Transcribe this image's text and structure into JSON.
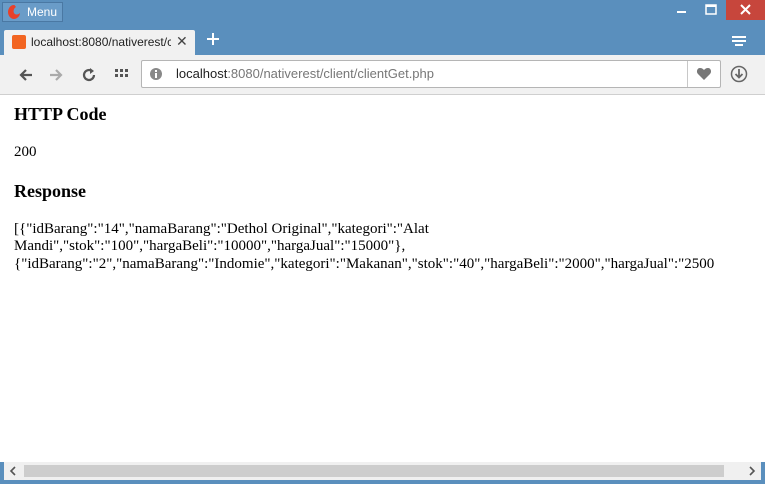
{
  "window": {
    "menu_label": "Menu",
    "accent": "#5a8fbd",
    "close_color": "#c7463c"
  },
  "tab": {
    "title": "localhost:8080/nativerest/c",
    "favicon": "xampp-icon"
  },
  "urlbar": {
    "host": "localhost",
    "path": ":8080/nativerest/client/clientGet.php"
  },
  "page": {
    "http_code_heading": "HTTP Code",
    "http_code_value": "200",
    "response_heading": "Response",
    "response_line1": "[{\"idBarang\":\"14\",\"namaBarang\":\"Dethol Original\",\"kategori\":\"Alat",
    "response_line2": "Mandi\",\"stok\":\"100\",\"hargaBeli\":\"10000\",\"hargaJual\":\"15000\"},",
    "response_line3": "{\"idBarang\":\"2\",\"namaBarang\":\"Indomie\",\"kategori\":\"Makanan\",\"stok\":\"40\",\"hargaBeli\":\"2000\",\"hargaJual\":\"2500"
  }
}
